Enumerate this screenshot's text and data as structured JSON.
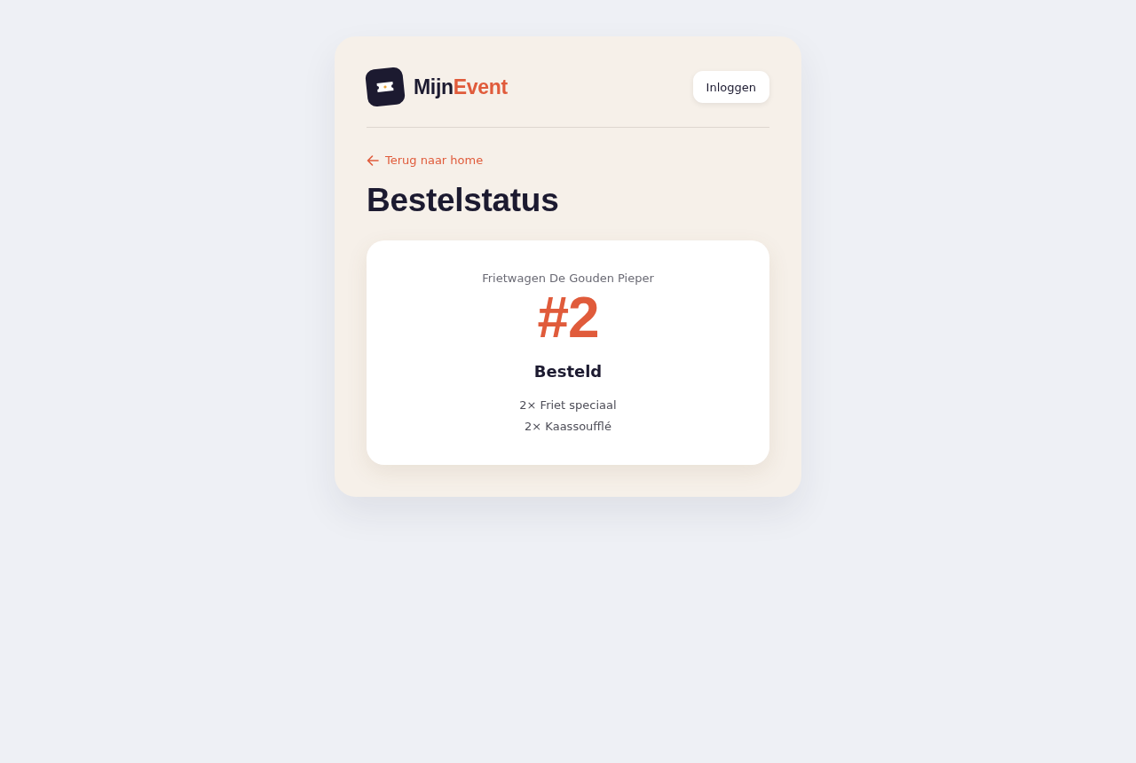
{
  "header": {
    "logo": {
      "text": "Mijn",
      "accent": "Event"
    },
    "login_button": "Inloggen"
  },
  "back_link": "Terug naar home",
  "title": "Bestelstatus",
  "order": {
    "vendor": "Frietwagen De Gouden Pieper",
    "number": "#2",
    "status": "Besteld",
    "items": [
      "2× Friet speciaal",
      "2× Kaassoufflé"
    ]
  }
}
